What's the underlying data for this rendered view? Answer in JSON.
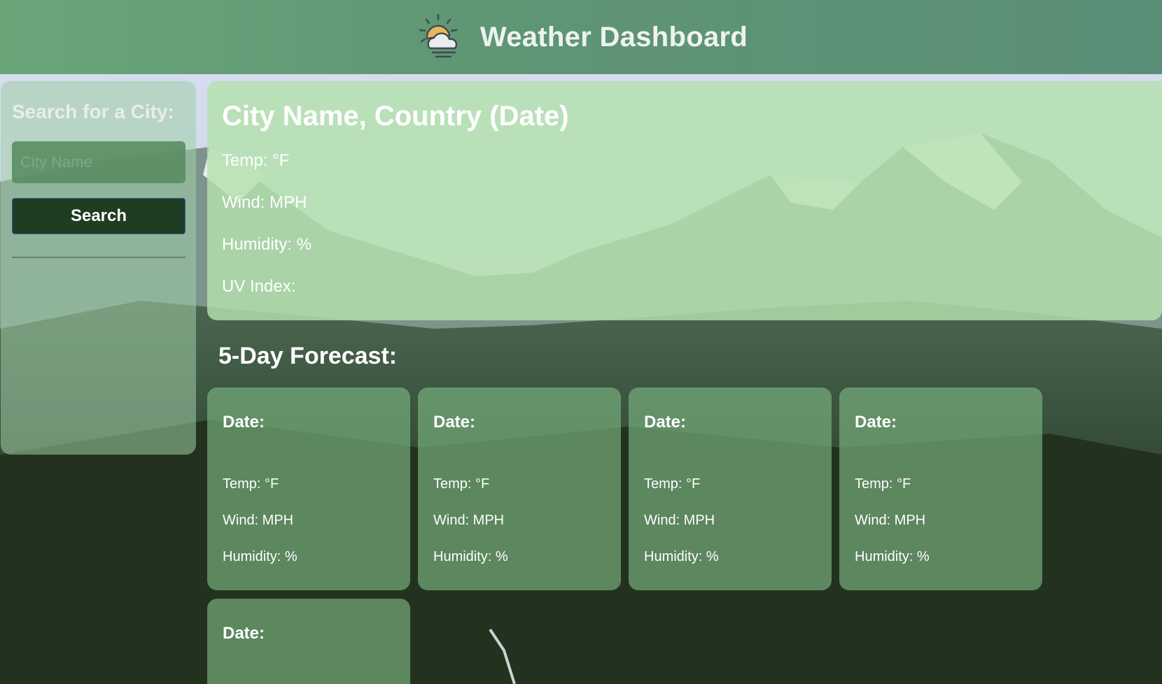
{
  "header": {
    "title": "Weather Dashboard",
    "logo_icon": "sun-behind-cloud-icon"
  },
  "sidebar": {
    "heading": "Search for a City:",
    "input_value": "",
    "input_placeholder": "City Name",
    "search_label": "Search"
  },
  "current": {
    "title": "City Name, Country (Date)",
    "temp": "Temp: °F",
    "wind": "Wind: MPH",
    "humidity": "Humidity: %",
    "uv": "UV Index:"
  },
  "forecast": {
    "title": "5-Day Forecast:",
    "cards": [
      {
        "date": "Date:",
        "temp": "Temp: °F",
        "wind": "Wind: MPH",
        "humidity": "Humidity: %"
      },
      {
        "date": "Date:",
        "temp": "Temp: °F",
        "wind": "Wind: MPH",
        "humidity": "Humidity: %"
      },
      {
        "date": "Date:",
        "temp": "Temp: °F",
        "wind": "Wind: MPH",
        "humidity": "Humidity: %"
      },
      {
        "date": "Date:",
        "temp": "Temp: °F",
        "wind": "Wind: MPH",
        "humidity": "Humidity: %"
      },
      {
        "date": "Date:"
      }
    ]
  },
  "colors": {
    "header_bg": "#5f9674",
    "sidebar_bg": "#a0cda5",
    "current_bg": "#b4e1af",
    "forecast_bg": "#78af7d",
    "search_button_bg": "#1f3d23",
    "search_button_border": "#3a5aa8"
  }
}
